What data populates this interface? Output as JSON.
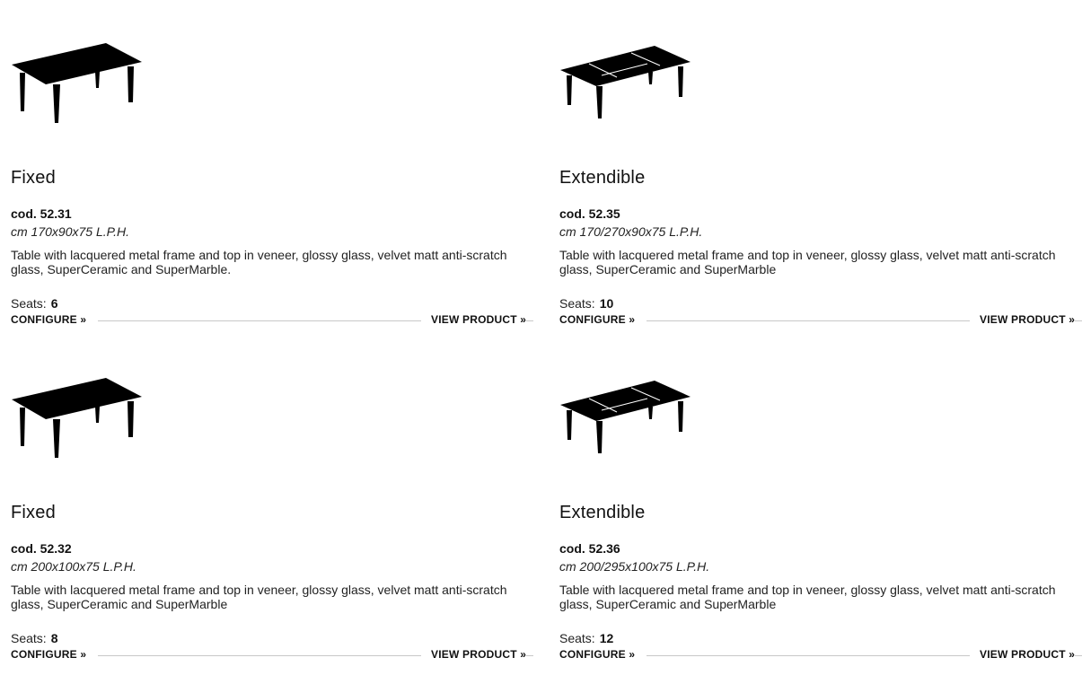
{
  "products": [
    {
      "icon": "fixed-table-icon",
      "title": "Fixed",
      "code": "cod. 52.31",
      "dimensions": "cm 170x90x75 L.P.H.",
      "description": "Table with lacquered metal frame and top in veneer, glossy glass, velvet matt anti-scratch glass, SuperCeramic and SuperMarble.",
      "seats_label": "Seats:",
      "seats": "6",
      "configure_label": "CONFIGURE »",
      "view_label": "VIEW PRODUCT »"
    },
    {
      "icon": "extendible-table-icon",
      "title": "Extendible",
      "code": "cod. 52.35",
      "dimensions": "cm 170/270x90x75 L.P.H.",
      "description": "Table with lacquered metal frame and top in veneer, glossy glass, velvet matt anti-scratch glass, SuperCeramic and SuperMarble",
      "seats_label": "Seats:",
      "seats": "10",
      "configure_label": "CONFIGURE »",
      "view_label": "VIEW PRODUCT »"
    },
    {
      "icon": "fixed-table-icon",
      "title": "Fixed",
      "code": "cod. 52.32",
      "dimensions": "cm 200x100x75 L.P.H.",
      "description": "Table with lacquered metal frame and top in veneer, glossy glass, velvet matt anti-scratch glass, SuperCeramic and SuperMarble",
      "seats_label": "Seats:",
      "seats": "8",
      "configure_label": "CONFIGURE »",
      "view_label": "VIEW PRODUCT »"
    },
    {
      "icon": "extendible-table-icon",
      "title": "Extendible",
      "code": "cod. 52.36",
      "dimensions": "cm 200/295x100x75 L.P.H.",
      "description": "Table with lacquered metal frame and top in veneer, glossy glass, velvet matt anti-scratch glass, SuperCeramic and SuperMarble",
      "seats_label": "Seats:",
      "seats": "12",
      "configure_label": "CONFIGURE »",
      "view_label": "VIEW PRODUCT »"
    }
  ]
}
